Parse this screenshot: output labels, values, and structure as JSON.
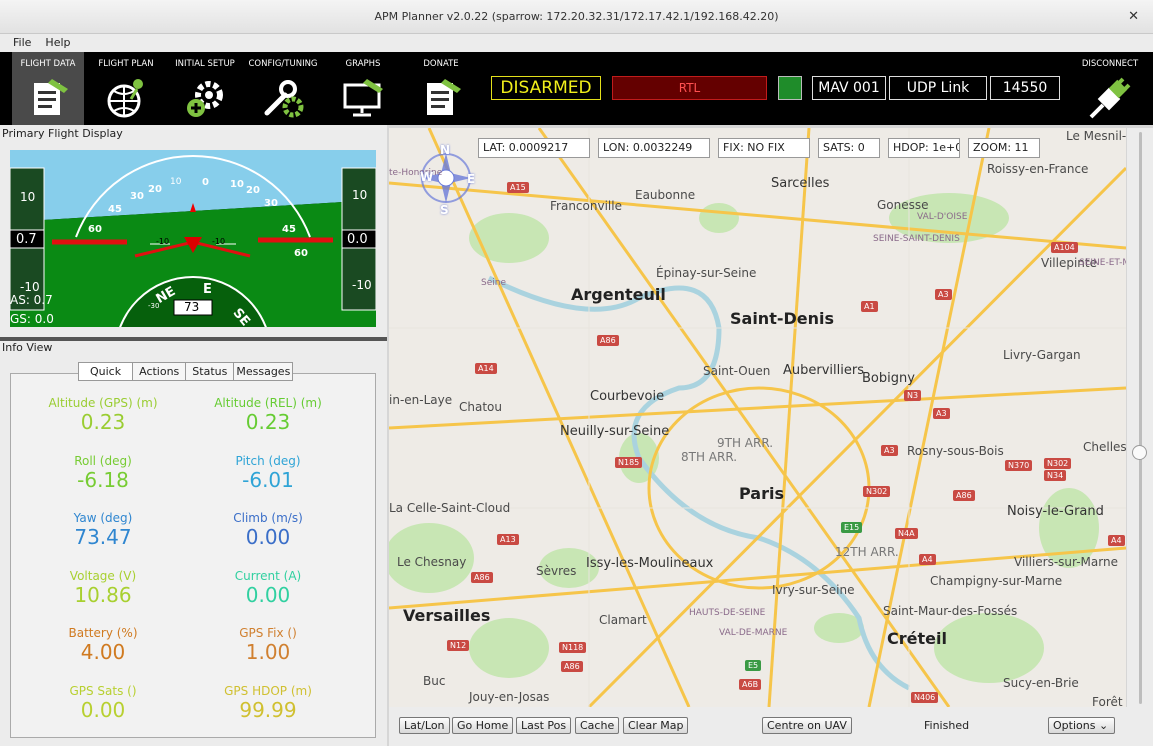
{
  "window": {
    "title": "APM Planner v2.0.22 (sparrow: 172.20.32.31/172.17.42.1/192.168.42.20)",
    "close": "✕"
  },
  "menu": [
    "File",
    "Help"
  ],
  "toolbar": {
    "buttons": [
      "FLIGHT DATA",
      "FLIGHT PLAN",
      "INITIAL SETUP",
      "CONFIG/TUNING",
      "GRAPHS",
      "DONATE"
    ],
    "active": "FLIGHT DATA",
    "arm_status": "DISARMED",
    "mode": "RTL",
    "mav": "MAV 001",
    "link": "UDP Link",
    "port": "14550",
    "disconnect": "DISCONNECT"
  },
  "pfd": {
    "title": "Primary Flight Display",
    "left_tape": {
      "ticks": [
        "10",
        "-10"
      ],
      "value": "0.7"
    },
    "right_tape": {
      "ticks": [
        "10",
        "-10"
      ],
      "value": "0.0"
    },
    "roll_scale": [
      "60",
      "45",
      "30",
      "20",
      "10",
      "0",
      "10",
      "20",
      "30",
      "45",
      "60"
    ],
    "pitch_marks": [
      "-10",
      "-10"
    ],
    "heading": "73",
    "compass": [
      "NE",
      "E",
      "SE",
      "-30"
    ],
    "airspeed": "AS: 0.7",
    "groundspeed": "GS: 0.0"
  },
  "info": {
    "title": "Info View",
    "tabs": [
      "Quick",
      "Actions",
      "Status",
      "Messages"
    ],
    "metrics": [
      {
        "label": "Altitude (GPS) (m)",
        "value": "0.23",
        "color": "#9acd32"
      },
      {
        "label": "Altitude (REL) (m)",
        "value": "0.23",
        "color": "#66cc33"
      },
      {
        "label": "Roll (deg)",
        "value": "-6.18",
        "color": "#77cc33"
      },
      {
        "label": "Pitch (deg)",
        "value": "-6.01",
        "color": "#2fa4d6"
      },
      {
        "label": "Yaw (deg)",
        "value": "73.47",
        "color": "#2f86d0"
      },
      {
        "label": "Climb (m/s)",
        "value": "0.00",
        "color": "#3a6ec8"
      },
      {
        "label": "Voltage (V)",
        "value": "10.86",
        "color": "#a8d030"
      },
      {
        "label": "Current (A)",
        "value": "0.00",
        "color": "#30d0a0"
      },
      {
        "label": "Battery (%)",
        "value": "4.00",
        "color": "#d07a20"
      },
      {
        "label": "GPS Fix ()",
        "value": "1.00",
        "color": "#d08030"
      },
      {
        "label": "GPS Sats ()",
        "value": "0.00",
        "color": "#b8d030"
      },
      {
        "label": "GPS HDOP (m)",
        "value": "99.99",
        "color": "#d0c030"
      }
    ]
  },
  "map": {
    "lat": "LAT: 0.0009217",
    "lon": "LON: 0.0032249",
    "fix": "FIX: NO FIX",
    "sats": "SATS: 0",
    "hdop": "HDOP: 1e+0",
    "zoom": "ZOOM: 11",
    "compass_letters": [
      "N",
      "W",
      "E",
      "S"
    ],
    "places": [
      "Sarcelles",
      "Eaubonne",
      "Gonesse",
      "Franconville",
      "Roissy-en-France",
      "Le Mesnil-A",
      "Villepinte",
      "Épinay-sur-Seine",
      "Argenteuil",
      "Saint-Denis",
      "Saint-Ouen",
      "Aubervilliers",
      "Bobigny",
      "Livry-Gargan",
      "Courbevoie",
      "Chatou",
      "Neuilly-sur-Seine",
      "9TH ARR.",
      "8TH ARR.",
      "Paris",
      "Rosny-sous-Bois",
      "Chelles",
      "Noisy-le-Grand",
      "La Celle-Saint-Cloud",
      "12TH ARR.",
      "Le Chesnay",
      "Sèvres",
      "Issy-les-Moulineaux",
      "Ivry-sur-Seine",
      "Villiers-sur-Marne",
      "Champigny-sur-Marne",
      "Versailles",
      "Clamart",
      "Saint-Maur-des-Fossés",
      "Créteil",
      "Buc",
      "Jouy-en-Josas",
      "Sucy-en-Brie",
      "Forêt",
      "in-en-Laye",
      "te-Honorine",
      "VAL-D'OISE",
      "SEINE-SAINT-DENIS",
      "SEINE-ET-MARNE",
      "HAUTS-DE-SEINE",
      "VAL-DE-MARNE",
      "Seine"
    ],
    "shields": [
      "A15",
      "A104",
      "A1",
      "A3",
      "A86",
      "A14",
      "N3",
      "A3",
      "N185",
      "A3",
      "N370",
      "N302",
      "N34",
      "N302",
      "A86",
      "E15",
      "N4A",
      "A4",
      "A13",
      "A86",
      "A4",
      "N118",
      "N12",
      "A86",
      "E5",
      "A6B",
      "N406"
    ],
    "buttons": [
      "Lat/Lon",
      "Go Home",
      "Last Pos",
      "Cache",
      "Clear Map",
      "Centre on UAV"
    ],
    "status": "Finished",
    "options": "Options"
  }
}
